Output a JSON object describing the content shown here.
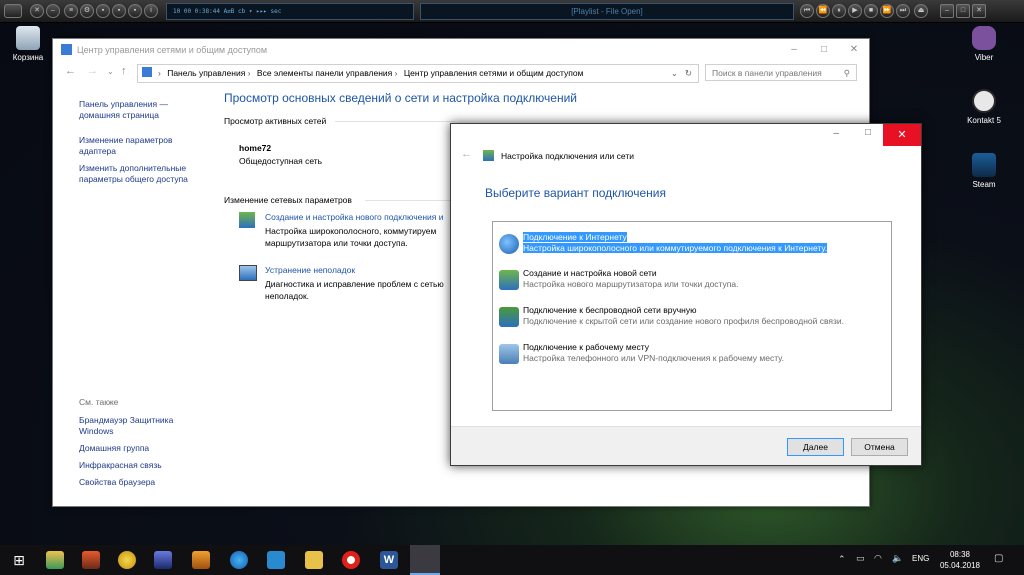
{
  "player": {
    "display_time": "10  00  0:38:44  A⇄B cb ▾ ▸▸▸  sec",
    "playlist_title": "[Playlist - File Open]"
  },
  "desktop": {
    "icons_left": [
      {
        "label": "Корзина"
      }
    ],
    "icons_right": [
      {
        "label": "Viber"
      },
      {
        "label": "Kontakt 5"
      },
      {
        "label": "Steam"
      }
    ]
  },
  "control_panel": {
    "title": "Центр управления сетями и общим доступом",
    "breadcrumb": [
      "Панель управления",
      "Все элементы панели управления",
      "Центр управления сетями и общим доступом"
    ],
    "search_placeholder": "Поиск в панели управления",
    "sidebar": {
      "home_line1": "Панель управления —",
      "home_line2": "домашняя страница",
      "adapter_line1": "Изменение параметров",
      "adapter_line2": "адаптера",
      "sharing_line1": "Изменить дополнительные",
      "sharing_line2": "параметры общего доступа",
      "see_also": "См. также",
      "firewall_line1": "Брандмауэр Защитника",
      "firewall_line2": "Windows",
      "homegroup": "Домашняя группа",
      "infrared": "Инфракрасная связь",
      "browser": "Свойства браузера"
    },
    "main_heading": "Просмотр основных сведений о сети и настройка подключений",
    "active_networks": "Просмотр активных сетей",
    "network_name": "home72",
    "network_type": "Общедоступная сеть",
    "change_settings": "Изменение сетевых параметров",
    "task1_title": "Создание и настройка нового подключения и",
    "task1_desc1": "Настройка широкополосного, коммутируем",
    "task1_desc2": "маршрутизатора или точки доступа.",
    "task2_title": "Устранение неполадок",
    "task2_desc1": "Диагностика и исправление проблем с сетью",
    "task2_desc2": "неполадок."
  },
  "dialog": {
    "title": "Настройка подключения или сети",
    "heading": "Выберите вариант подключения",
    "options": [
      {
        "title": "Подключение к Интернету",
        "desc": "Настройка широкополосного или коммутируемого подключения к Интернету.",
        "selected": true
      },
      {
        "title": "Создание и настройка новой сети",
        "desc": "Настройка нового маршрутизатора или точки доступа.",
        "selected": false
      },
      {
        "title": "Подключение к беспроводной сети вручную",
        "desc": "Подключение к скрытой сети или создание нового профиля беспроводной связи.",
        "selected": false
      },
      {
        "title": "Подключение к рабочему месту",
        "desc": "Настройка телефонного или VPN-подключения к рабочему месту.",
        "selected": false
      }
    ],
    "next_label": "Далее",
    "cancel_label": "Отмена"
  },
  "taskbar": {
    "language": "ENG",
    "time": "08:38",
    "date": "05.04.2018"
  },
  "colors": {
    "accent": "#3399ff",
    "link": "#1e55a8",
    "close": "#e81123"
  }
}
